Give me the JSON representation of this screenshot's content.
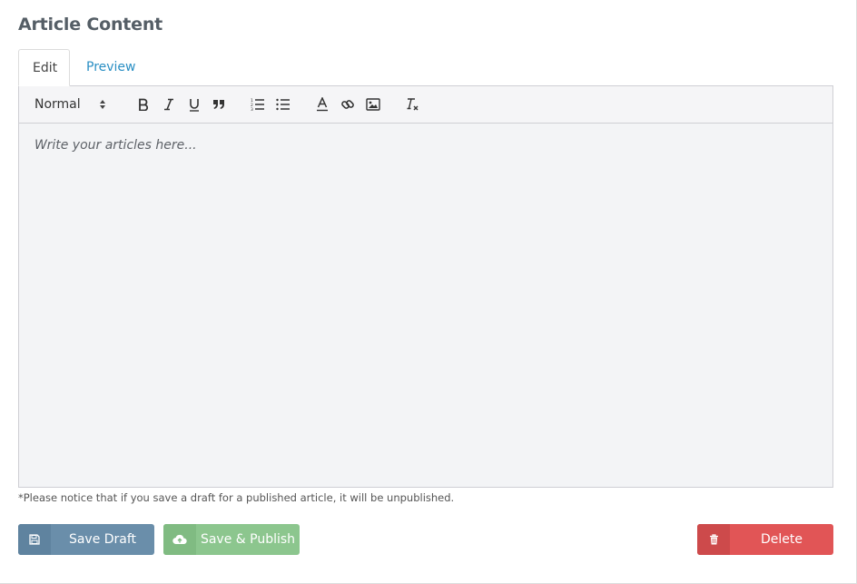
{
  "section": {
    "title": "Article Content"
  },
  "tabs": [
    {
      "label": "Edit",
      "active": true
    },
    {
      "label": "Preview",
      "active": false
    }
  ],
  "toolbar": {
    "format_select_value": "Normal",
    "buttons": [
      "bold-icon",
      "italic-icon",
      "underline-icon",
      "blockquote-icon",
      "ordered-list-icon",
      "bullet-list-icon",
      "text-color-icon",
      "link-icon",
      "image-icon",
      "clear-formatting-icon"
    ]
  },
  "editor": {
    "placeholder": "Write your articles here..."
  },
  "notice": "*Please notice that if you save a draft for a published article, it will be unpublished.",
  "actions": {
    "save_draft": "Save Draft",
    "save_publish": "Save & Publish",
    "delete": "Delete"
  },
  "colors": {
    "link": "#2a8fc4",
    "save_draft": "#6a8eaa",
    "save_publish": "#8cc68e",
    "delete": "#e15556"
  }
}
